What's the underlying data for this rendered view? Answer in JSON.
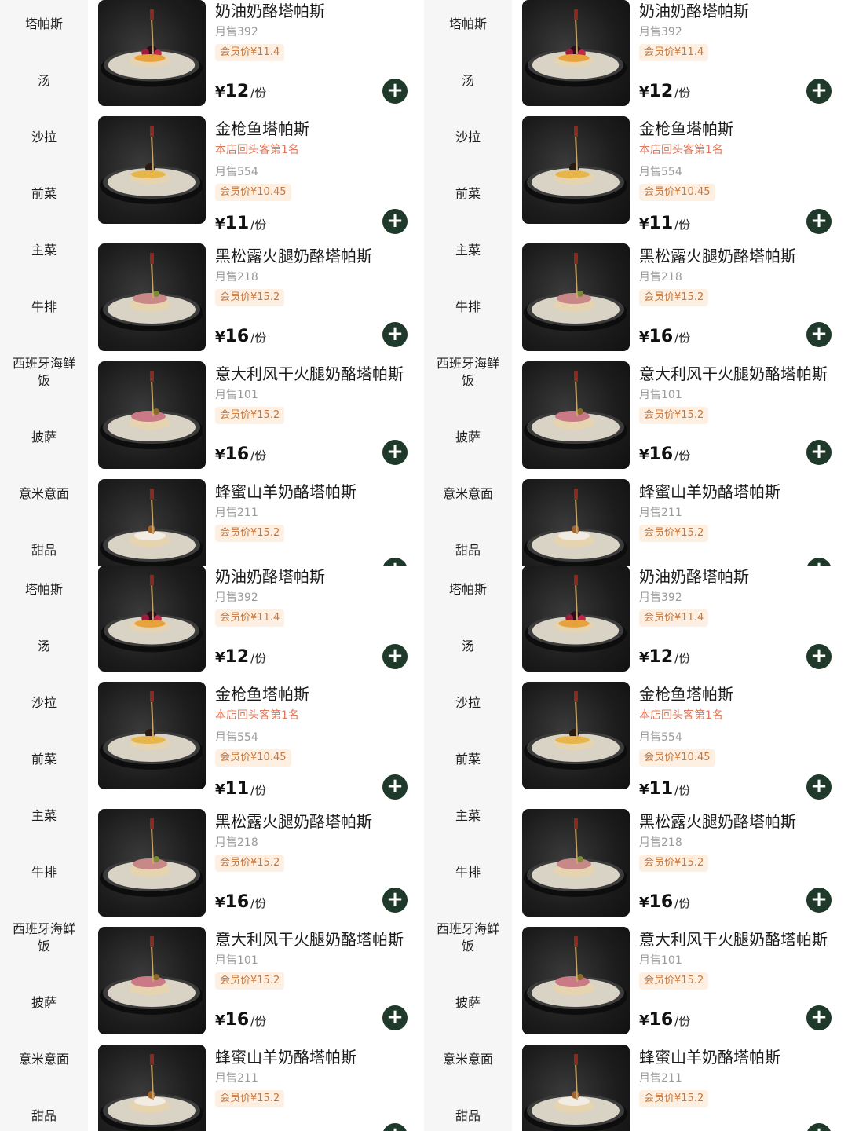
{
  "colors": {
    "sidebar_bg": "#f6f6f6",
    "accent_green": "#1f3a2a",
    "tag_red": "#e07a5f",
    "member_text": "#c8763a",
    "member_bg": "#fdf0e3"
  },
  "categories": [
    "塔帕斯",
    "汤",
    "沙拉",
    "前菜",
    "主菜",
    "牛排",
    "西班牙海鲜饭",
    "披萨",
    "意米意面",
    "甜品"
  ],
  "items": [
    {
      "name": "奶油奶酪塔帕斯",
      "tag": "",
      "sales": "月售392",
      "member_price": "会员价¥11.4",
      "currency": "¥",
      "price": "12",
      "unit": "/份",
      "add_icon": "plus-icon"
    },
    {
      "name": "金枪鱼塔帕斯",
      "tag": "本店回头客第1名",
      "sales": "月售554",
      "member_price": "会员价¥10.45",
      "currency": "¥",
      "price": "11",
      "unit": "/份",
      "add_icon": "plus-icon"
    },
    {
      "name": "黑松露火腿奶酪塔帕斯",
      "tag": "",
      "sales": "月售218",
      "member_price": "会员价¥15.2",
      "currency": "¥",
      "price": "16",
      "unit": "/份",
      "add_icon": "plus-icon"
    },
    {
      "name": "意大利风干火腿奶酪塔帕斯",
      "tag": "",
      "sales": "月售101",
      "member_price": "会员价¥15.2",
      "currency": "¥",
      "price": "16",
      "unit": "/份",
      "add_icon": "plus-icon"
    },
    {
      "name": "蜂蜜山羊奶酪塔帕斯",
      "tag": "",
      "sales": "月售211",
      "member_price": "会员价¥15.2",
      "currency": "¥",
      "price": "",
      "unit": "",
      "add_icon": "plus-icon"
    }
  ],
  "add_symbol": "+"
}
